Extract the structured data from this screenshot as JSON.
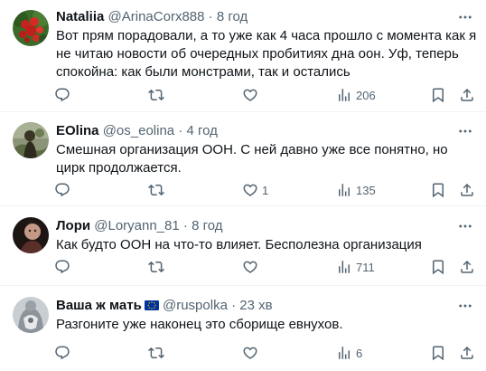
{
  "tweets": [
    {
      "name": "Nataliia",
      "handle": "@ArinaCorx888",
      "time": "8 год",
      "text": "Вот прям порадовали, а то уже как 4 часа прошло с момента как я не читаю новости об очередных пробитиях дна оон. Уф, теперь спокойна: как были монстрами, так и остались",
      "replies": "",
      "reposts": "",
      "likes": "",
      "views": "206"
    },
    {
      "name": "EOlina",
      "handle": "@os_eolina",
      "time": "4 год",
      "text": "Смешная организация ООН. С ней давно уже все понятно, но цирк продолжается.",
      "replies": "",
      "reposts": "",
      "likes": "1",
      "views": "135"
    },
    {
      "name": "Лори",
      "handle": "@Loryann_81",
      "time": "8 год",
      "text": "Как будто ООН на что-то влияет. Бесполезна организация",
      "replies": "",
      "reposts": "",
      "likes": "",
      "views": "711"
    },
    {
      "name": "Ваша ж мать",
      "handle": "@ruspolka",
      "time": "23 хв",
      "text": "Разгоните уже наконец это сборище евнухов.",
      "replies": "",
      "reposts": "",
      "likes": "",
      "views": "6"
    }
  ],
  "separator": "·",
  "icons": {
    "reply": "reply-icon",
    "repost": "repost-icon",
    "like": "heart-icon",
    "views": "views-chart-icon",
    "bookmark": "bookmark-icon",
    "share": "share-icon",
    "more": "more-dots-icon",
    "flag": "eu-flag-icon"
  },
  "colors": {
    "text": "#0f1419",
    "secondary": "#536471",
    "divider": "#eff3f4",
    "flag_blue": "#0033a0",
    "flag_stars": "#ffcc00"
  }
}
